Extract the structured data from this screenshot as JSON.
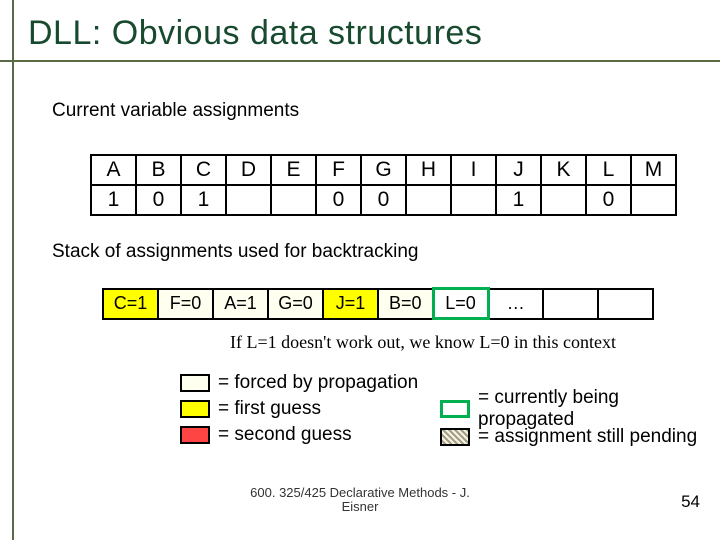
{
  "title": "DLL: Obvious data structures",
  "sub1": "Current variable assignments",
  "vars": {
    "h": [
      "A",
      "B",
      "C",
      "D",
      "E",
      "F",
      "G",
      "H",
      "I",
      "J",
      "K",
      "L",
      "M"
    ],
    "v": [
      "1",
      "0",
      "1",
      "",
      "",
      "0",
      "0",
      "",
      "",
      "1",
      "",
      "0",
      ""
    ]
  },
  "sub2": "Stack of assignments used for backtracking",
  "stack": [
    "C=1",
    "F=0",
    "A=1",
    "G=0",
    "J=1",
    "B=0",
    "L=0",
    "…",
    "",
    ""
  ],
  "note": "If L=1 doesn't work out, we know L=0 in this context",
  "legend": {
    "forced": "= forced by propagation",
    "first": "= first guess",
    "second": "= second guess",
    "prop": "= currently being propagated",
    "pend": "= assignment still pending"
  },
  "footer1": "600. 325/425 Declarative Methods - J.",
  "footer2": "Eisner",
  "slidenum": "54"
}
